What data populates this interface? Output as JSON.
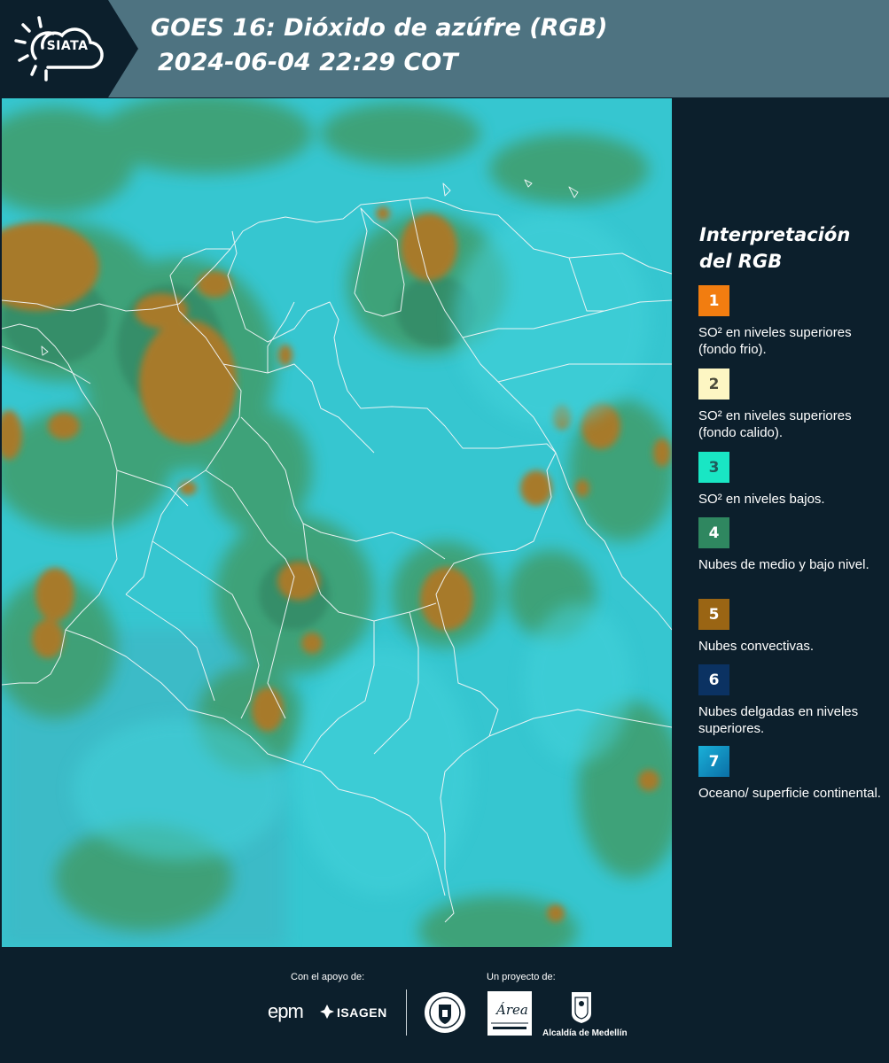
{
  "header": {
    "logo_text": "SIATA",
    "title_line1": "GOES 16: Dióxido de azúfre (RGB)",
    "title_line2": "2024-06-04 22:29 COT"
  },
  "legend": {
    "title": "Interpretación del RGB",
    "items": [
      {
        "number": "1",
        "color": "#f27d10",
        "text": "SO² en niveles superiores (fondo frio)."
      },
      {
        "number": "2",
        "color": "#fdf6c3",
        "text": "SO² en niveles superiores (fondo calido)."
      },
      {
        "number": "3",
        "color": "#19e6c4",
        "text": "SO² en niveles bajos."
      },
      {
        "number": "4",
        "color": "#2f8760",
        "text": "Nubes de medio y bajo nivel."
      },
      {
        "number": "5",
        "color": "#9a6514",
        "text": "Nubes convectivas."
      },
      {
        "number": "6",
        "color": "#0b3262",
        "text": "Nubes delgadas en niveles superiores."
      },
      {
        "number": "7",
        "color": "#0f8ec2",
        "text": "Oceano/ superficie continental."
      }
    ]
  },
  "footer": {
    "support_label": "Con el apoyo de:",
    "project_label": "Un proyecto de:",
    "epm_logo_text": "epm",
    "isagen_logo_text": "ISAGEN",
    "alcaldia_text": "Alcaldía de Medellín",
    "amva_logo_text": "Área"
  },
  "colors": {
    "background": "#0c1f2c",
    "header_bar": "#4e7381",
    "map_base": "#36c6d0",
    "cloud_green": "#3d9b66",
    "cloud_brown": "#a3782c"
  },
  "map": {
    "description_icon": "satellite-rgb-imagery"
  }
}
